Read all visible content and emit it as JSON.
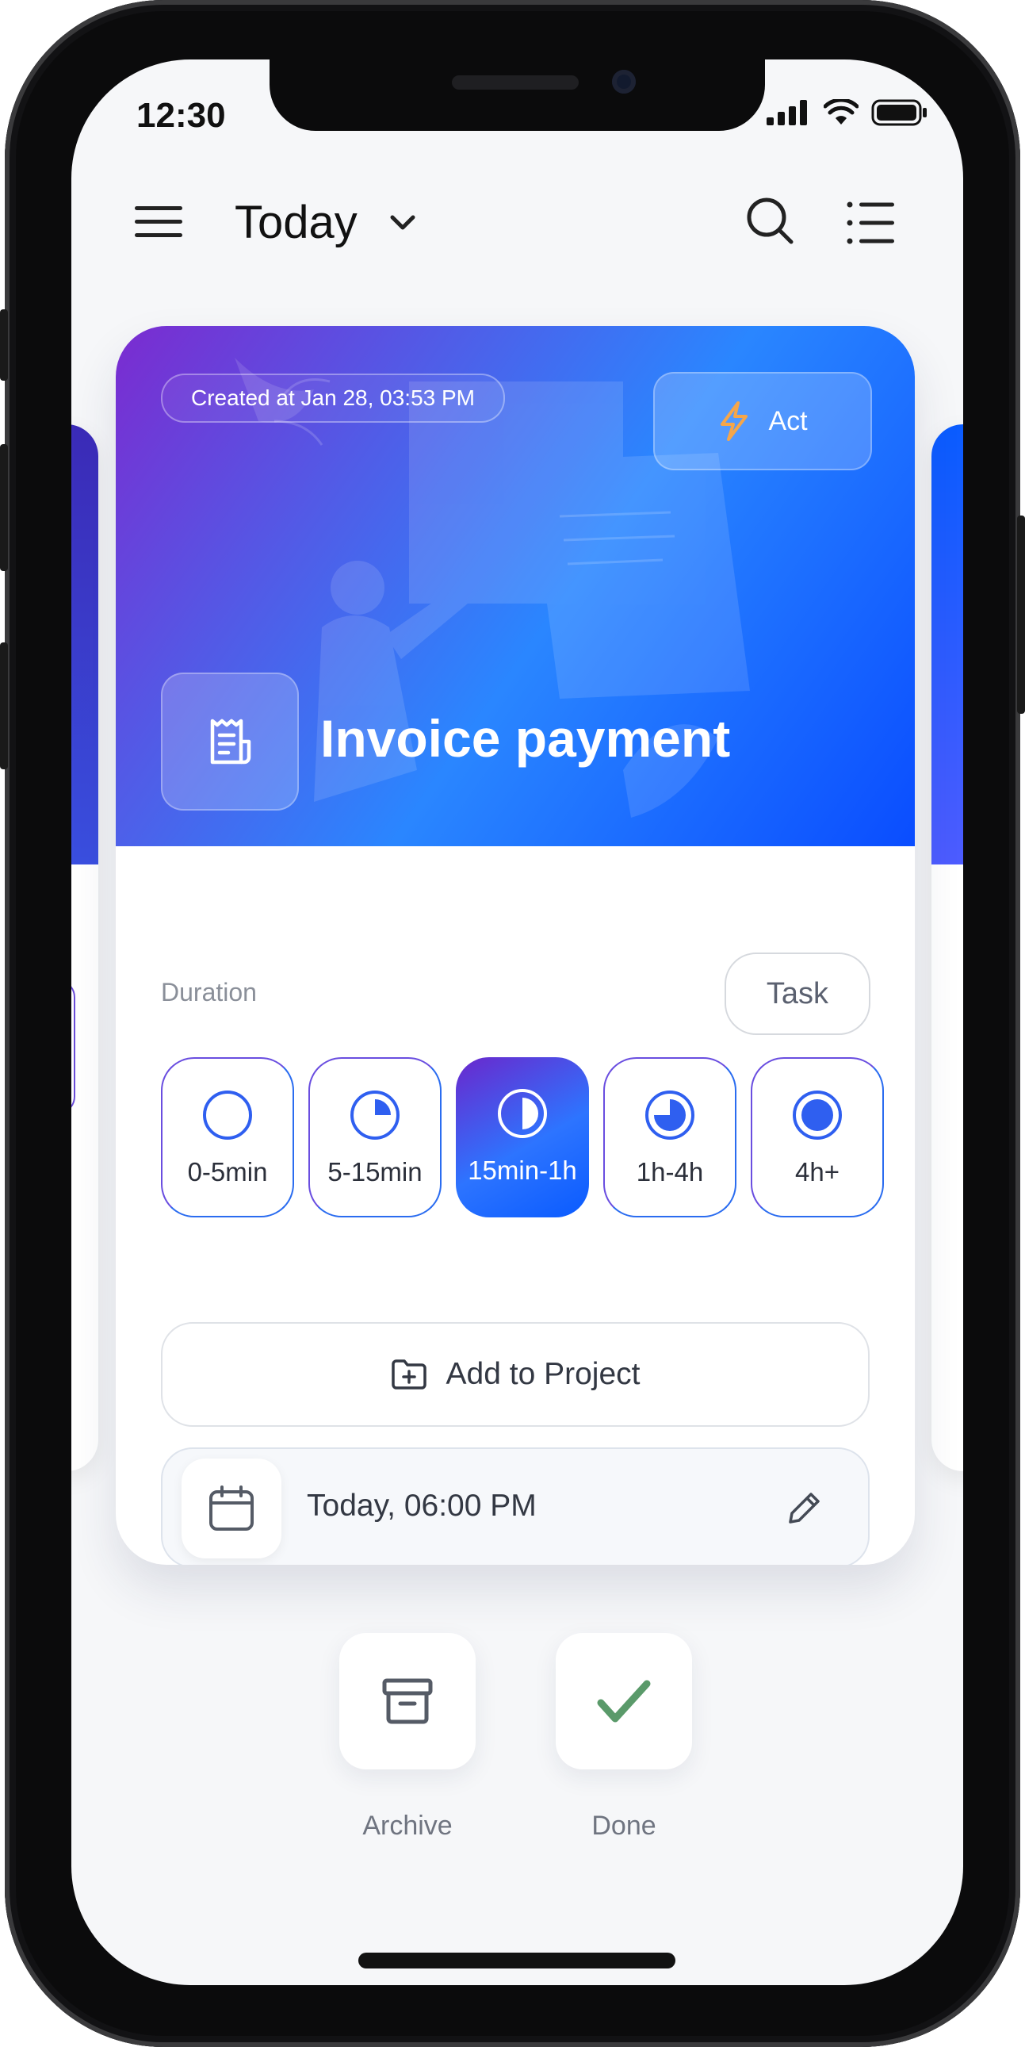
{
  "status_bar": {
    "time": "12:30"
  },
  "header": {
    "title": "Today",
    "menu_icon": "hamburger-icon",
    "search_icon": "search-icon",
    "list_icon": "list-icon"
  },
  "task_card": {
    "created": "Created at Jan 28, 03:53 PM",
    "act_label": "Act",
    "title": "Invoice payment",
    "type_tag": "Task",
    "duration_label": "Duration",
    "duration_options": [
      {
        "label": "0-5min",
        "fill": 0
      },
      {
        "label": "5-15min",
        "fill": 0.25
      },
      {
        "label": "15min-1h",
        "fill": 0.5
      },
      {
        "label": "1h-4h",
        "fill": 0.75
      },
      {
        "label": "4h+",
        "fill": 1
      }
    ],
    "selected_duration": "15min-1h",
    "add_project_label": "Add to Project",
    "schedule": "Today, 06:00 PM"
  },
  "actions": {
    "archive_label": "Archive",
    "done_label": "Done"
  },
  "colors": {
    "accent_blue": "#0a5bff",
    "accent_purple": "#7b2bd0",
    "done_green": "#5a9a6a",
    "act_bolt": "#f5a64a"
  }
}
